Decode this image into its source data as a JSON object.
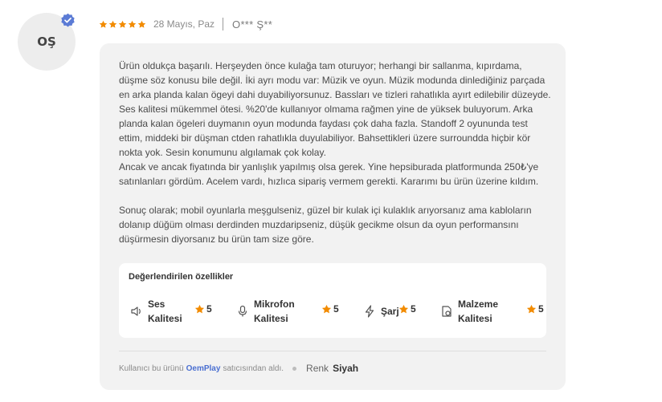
{
  "reviewer": {
    "initials": "OŞ",
    "masked_name": "O*** Ş**",
    "verified_color": "#5b7bd5"
  },
  "review": {
    "rating": 5,
    "date": "28 Mayıs, Paz",
    "star_color": "#f28b00",
    "paragraph1": "Ürün oldukça başarılı. Herşeyden önce kulağa tam oturuyor; herhangi bir sallanma, kıpırdama, düşme söz konusu bile değil. İki ayrı modu var: Müzik ve oyun. Müzik modunda dinlediğiniz parçada en arka planda kalan ögeyi dahi duyabiliyorsunuz. Bassları ve tizleri rahatlıkla ayırt edilebilir düzeyde. Ses kalitesi mükemmel ötesi. %20'de kullanıyor olmama rağmen yine de yüksek buluyorum. Arka planda kalan ögeleri duymanın oyun modunda faydası çok daha fazla. Standoff 2 oyununda test ettim, mіddeki bir düşman ctden rahatlıkla duyulabiliyor. Bahsettikleri üzere surroundda hiçbir kör nokta yok. Sesin konumunu algılamak çok kolay.",
    "paragraph2": "Ancak ve ancak fiyatında bir yanlışlık yapılmış olsa gerek. Yine hepsiburada platformunda 250₺'ye satınlanları gördüm. Acelem vardı, hızlıca siparіş vermem gerekti. Kararımı bu ürün üzerine kıldım.",
    "paragraph3": "Sonuç olarak; mobil oyunlarla meşgulseniz, güzel bir kulak içi kulaklık arıyorsanız ama kabloların dolanıp düğüm olması derdinden muzdaripseniz, düşük gecikme olsun da oyun performansını düşürmesin diyorsanız bu ürün tam size göre."
  },
  "features": {
    "title": "Değerlendirilen özellikler",
    "items": [
      {
        "icon": "speaker-icon",
        "label_line1": "Ses",
        "label_line2": "Kalitesi",
        "score": "5"
      },
      {
        "icon": "microphone-icon",
        "label_line1": "Mikrofon",
        "label_line2": "Kalitesi",
        "score": "5"
      },
      {
        "icon": "bolt-icon",
        "label_line1": "Şarj",
        "label_line2": "",
        "score": "5"
      },
      {
        "icon": "material-icon",
        "label_line1": "Malzeme",
        "label_line2": "Kalitesi",
        "score": "5"
      }
    ]
  },
  "footer": {
    "prefix": "Kullanıcı bu ürünü",
    "seller": "OemPlay",
    "suffix": "satıcısından aldı.",
    "attr_name": "Renk",
    "attr_value": "Siyah"
  }
}
